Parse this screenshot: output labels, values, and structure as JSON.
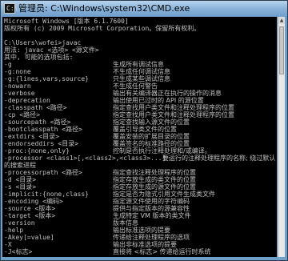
{
  "window": {
    "title": "管理员: C:\\Windows\\system32\\CMD.exe",
    "icon": "cmd-icon"
  },
  "console": {
    "lines": [
      "Microsoft Windows [版本 6.1.7600]",
      "版权所有 (c) 2009 Microsoft Corporation。保留所有权利。",
      "",
      "C:\\Users\\wofei>javac",
      "用法: javac <选项> <源文件>",
      "其中, 可能的选项包括:",
      "  -g",
      "  -g:none",
      "  -g:{lines,vars,source}",
      "  -nowarn",
      "  -verbose",
      "  -deprecation",
      "  -classpath <路径>",
      "  -cp <路径>",
      "  -sourcepath <路径>",
      "  -bootclasspath <路径>",
      "  -extdirs <目录>",
      "  -endorseddirs <目录>",
      "  -proc:{none,only}",
      "  -processor <class1>[,<class2>,<class3>...]",
      "的搜索进程",
      "  -processorpath <路径>",
      "  -d <目录>",
      "  -s <目录>",
      "  -implicit:{none,class}",
      "  -encoding <编码>",
      "  -source <版本>",
      "  -target <版本>",
      "  -version",
      "  -help",
      "  -Akey[=value]",
      "  -X",
      "  -J<标志>"
    ],
    "descriptions": [
      "生成所有调试信息",
      "不生成任何调试信息",
      "只生成某些调试信息",
      "不生成任何警告",
      "输出有关编译器正在执行的操作的消息",
      "输出使用已过时的 API 的源位置",
      "指定查找用户类文件和注释处理程序的位置",
      "指定查找用户类文件和注释处理程序的位置",
      "指定查找输入源文件的位置",
      "覆盖引导类文件的位置",
      "覆盖安装的扩展目录的位置",
      "覆盖签名的标准路径的位置",
      "控制是否执行注释处理和/或编译。",
      "要运行的注释处理程序的名称; 绕过默认",
      "",
      "指定查找注释处理程序的位置",
      "指定存放生成的类文件的位置",
      "指定存放生成的源文件的位置",
      "指定是否为隐式引用文件生成类文件",
      "指定源文件使用的字符编码",
      "提供与指定版本的源兼容性",
      "生成特定 VM 版本的类文件",
      "版本信息",
      "输出标准选项的提要",
      "传递给注释处理程序的选项",
      "输出非标准选项的提要",
      "直接将 <标志> 传递给运行时系统"
    ]
  },
  "colors": {
    "console_bg": "#000000",
    "console_text": "#c0c0c0",
    "titlebar": "#86b0d8"
  }
}
